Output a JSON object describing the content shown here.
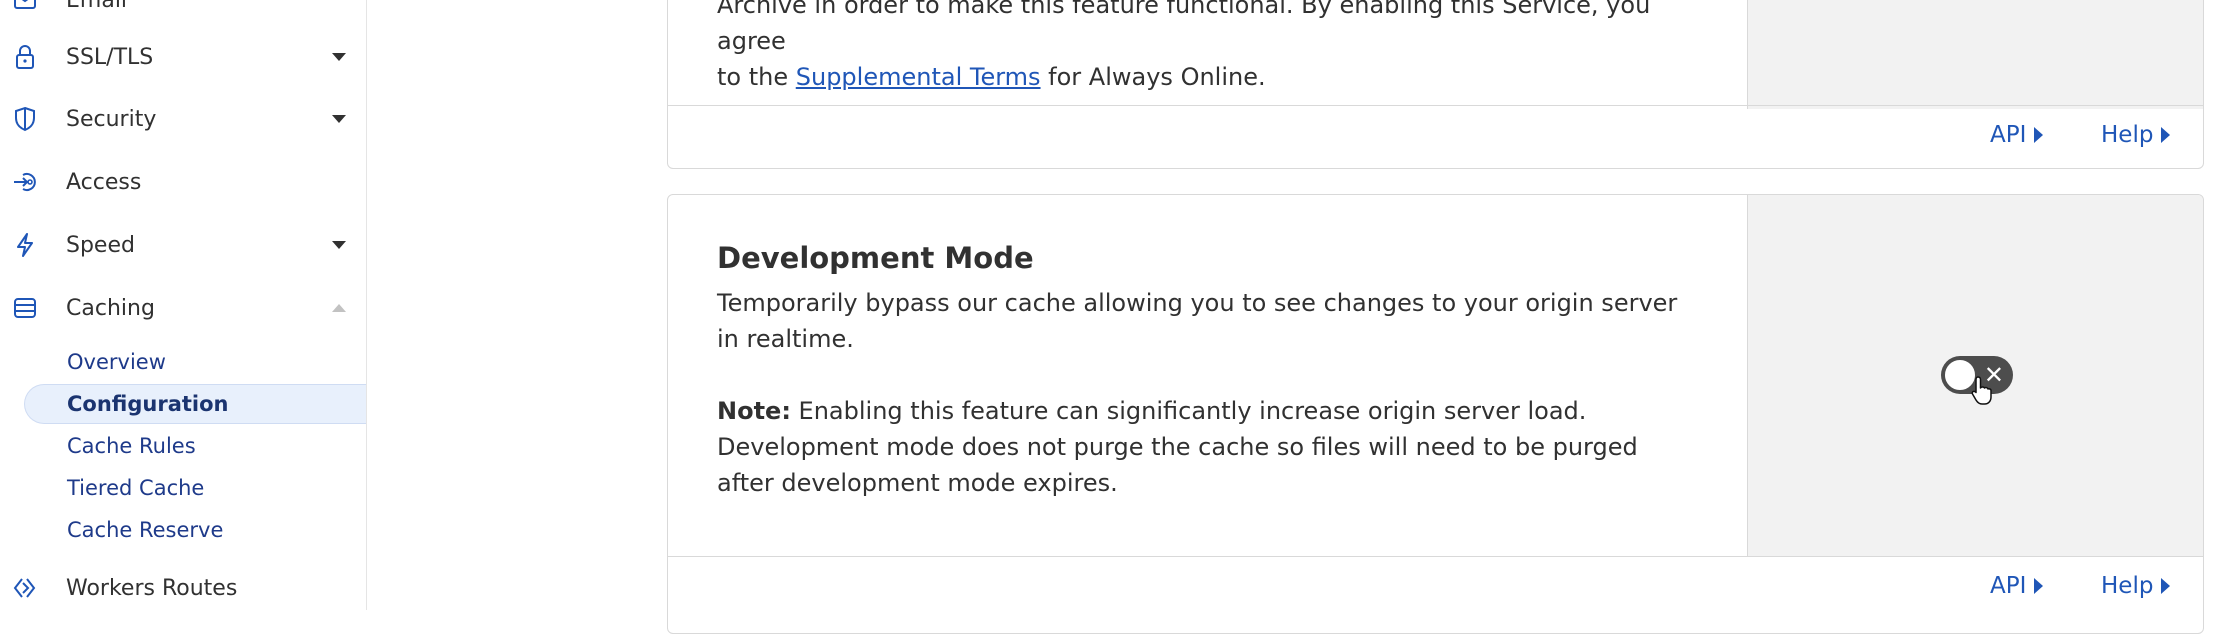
{
  "sidebar": {
    "items": [
      {
        "label": "Email",
        "icon": "email-icon"
      },
      {
        "label": "SSL/TLS",
        "icon": "lock-icon",
        "expandable": true
      },
      {
        "label": "Security",
        "icon": "shield-icon",
        "expandable": true
      },
      {
        "label": "Access",
        "icon": "access-icon"
      },
      {
        "label": "Speed",
        "icon": "lightning-icon",
        "expandable": true
      },
      {
        "label": "Caching",
        "icon": "caching-icon",
        "expanded": true
      },
      {
        "label": "Workers Routes",
        "icon": "workers-icon"
      }
    ],
    "caching_sub": [
      {
        "label": "Overview"
      },
      {
        "label": "Configuration",
        "active": true
      },
      {
        "label": "Cache Rules"
      },
      {
        "label": "Tiered Cache"
      },
      {
        "label": "Cache Reserve"
      }
    ]
  },
  "always_online_card": {
    "desc_line1": "Archive in order to make this feature functional. By enabling this Service, you agree",
    "desc_prefix": "to the ",
    "desc_link": "Supplemental Terms",
    "desc_suffix": " for Always Online.",
    "api_label": "API",
    "help_label": "Help"
  },
  "dev_mode_card": {
    "title": "Development Mode",
    "description": "Temporarily bypass our cache allowing you to see changes to your origin server in realtime.",
    "note_label": "Note:",
    "note_text": " Enabling this feature can significantly increase origin server load. Development mode does not purge the cache so files will need to be purged after development mode expires.",
    "toggle_state": "off",
    "toggle_symbol": "✕",
    "api_label": "API",
    "help_label": "Help"
  },
  "colors": {
    "accent": "#1f56b7",
    "toggle_off": "#4d4d4d",
    "side_panel": "#f2f2f2",
    "active_nav": "#e8f0fc"
  }
}
